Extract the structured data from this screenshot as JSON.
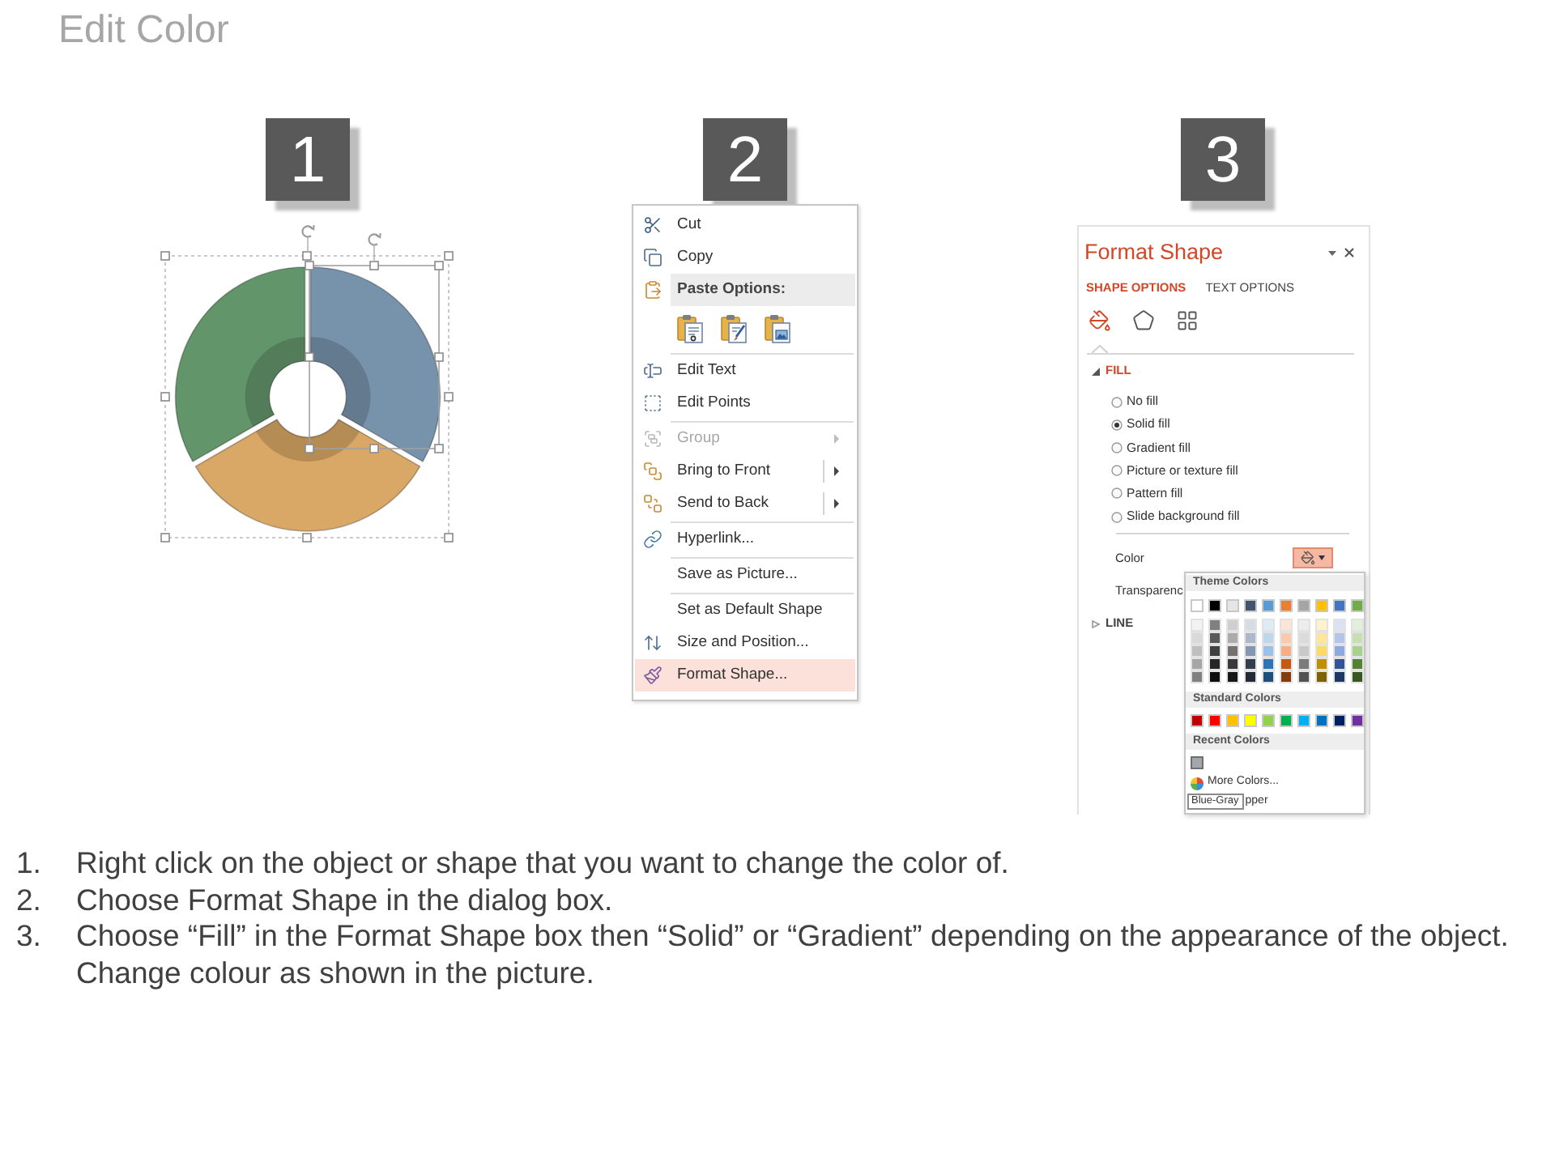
{
  "title": "Edit Color",
  "step_badges": [
    "1",
    "2",
    "3"
  ],
  "illustration": {
    "segments": [
      {
        "color": "#63956b"
      },
      {
        "color": "#7792ab"
      },
      {
        "color": "#d9a766"
      }
    ]
  },
  "context_menu": {
    "entries": [
      {
        "kind": "item",
        "label": "Cut",
        "disabled": false,
        "submenu": false,
        "split_button": false,
        "selected": false
      },
      {
        "kind": "item",
        "label": "Copy",
        "disabled": false,
        "submenu": false,
        "split_button": false,
        "selected": false
      },
      {
        "kind": "header",
        "label": "Paste Options:"
      },
      {
        "kind": "paste_options"
      },
      {
        "kind": "separator"
      },
      {
        "kind": "item",
        "label": "Edit Text",
        "disabled": false,
        "submenu": false,
        "split_button": false,
        "selected": false
      },
      {
        "kind": "item",
        "label": "Edit Points",
        "disabled": false,
        "submenu": false,
        "split_button": false,
        "selected": false
      },
      {
        "kind": "separator"
      },
      {
        "kind": "item",
        "label": "Group",
        "disabled": true,
        "submenu": true,
        "split_button": false,
        "selected": false
      },
      {
        "kind": "item",
        "label": "Bring to Front",
        "disabled": false,
        "submenu": true,
        "split_button": true,
        "selected": false
      },
      {
        "kind": "item",
        "label": "Send to Back",
        "disabled": false,
        "submenu": true,
        "split_button": true,
        "selected": false
      },
      {
        "kind": "separator"
      },
      {
        "kind": "item",
        "label": "Hyperlink...",
        "disabled": false,
        "submenu": false,
        "split_button": false,
        "selected": false
      },
      {
        "kind": "separator"
      },
      {
        "kind": "item",
        "label": "Save as Picture...",
        "disabled": false,
        "submenu": false,
        "split_button": false,
        "selected": false
      },
      {
        "kind": "separator"
      },
      {
        "kind": "item",
        "label": "Set as Default Shape",
        "disabled": false,
        "submenu": false,
        "split_button": false,
        "selected": false
      },
      {
        "kind": "item",
        "label": "Size and Position...",
        "disabled": false,
        "submenu": false,
        "split_button": false,
        "selected": false
      },
      {
        "kind": "item",
        "label": "Format Shape...",
        "disabled": false,
        "submenu": false,
        "split_button": false,
        "selected": true
      }
    ]
  },
  "format_panel": {
    "title": "Format Shape",
    "tabs": [
      {
        "label": "SHAPE OPTIONS",
        "selected": true
      },
      {
        "label": "TEXT OPTIONS",
        "selected": false
      }
    ],
    "icon_tabs": [
      {
        "selected": true
      },
      {
        "selected": false
      },
      {
        "selected": false
      }
    ],
    "fill_section": {
      "label": "FILL",
      "expanded": true
    },
    "fill_options": [
      {
        "label": "No fill",
        "selected": false
      },
      {
        "label": "Solid fill",
        "selected": true
      },
      {
        "label": "Gradient fill",
        "selected": false
      },
      {
        "label": "Picture or texture fill",
        "selected": false
      },
      {
        "label": "Pattern fill",
        "selected": false
      },
      {
        "label": "Slide background fill",
        "selected": false
      }
    ],
    "color_label": "Color",
    "color_button": {
      "open": true
    },
    "transparency_label": "Transparenc",
    "line_section": {
      "label": "LINE",
      "expanded": false
    },
    "palette": {
      "theme_title": "Theme Colors",
      "theme_colors": [
        {
          "color": "#ffffff",
          "shades": [
            {
              "color": "#f2f2f2"
            },
            {
              "color": "#d9d9d9"
            },
            {
              "color": "#bfbfbf"
            },
            {
              "color": "#a6a6a6"
            },
            {
              "color": "#808080"
            }
          ]
        },
        {
          "color": "#000000",
          "shades": [
            {
              "color": "#808080"
            },
            {
              "color": "#595959"
            },
            {
              "color": "#404040"
            },
            {
              "color": "#262626"
            },
            {
              "color": "#0d0d0d"
            }
          ]
        },
        {
          "color": "#e7e6e6",
          "shades": [
            {
              "color": "#d0cece"
            },
            {
              "color": "#aeaaaa"
            },
            {
              "color": "#757171"
            },
            {
              "color": "#3a3838"
            },
            {
              "color": "#171616"
            }
          ]
        },
        {
          "color": "#44546a",
          "shades": [
            {
              "color": "#d6dce4"
            },
            {
              "color": "#adb9ca"
            },
            {
              "color": "#8497b0"
            },
            {
              "color": "#333f4f"
            },
            {
              "color": "#222a35"
            }
          ]
        },
        {
          "color": "#5b9bd5",
          "shades": [
            {
              "color": "#ddebf7"
            },
            {
              "color": "#bdd7ee"
            },
            {
              "color": "#9bc2e6"
            },
            {
              "color": "#2f75b5"
            },
            {
              "color": "#1f4e78"
            }
          ]
        },
        {
          "color": "#ed7d31",
          "shades": [
            {
              "color": "#fce4d6"
            },
            {
              "color": "#f8cbad"
            },
            {
              "color": "#f4b084"
            },
            {
              "color": "#c65911"
            },
            {
              "color": "#833c0c"
            }
          ]
        },
        {
          "color": "#a5a5a5",
          "shades": [
            {
              "color": "#ededed"
            },
            {
              "color": "#dbdbdb"
            },
            {
              "color": "#c9c9c9"
            },
            {
              "color": "#7b7b7b"
            },
            {
              "color": "#525252"
            }
          ]
        },
        {
          "color": "#ffc000",
          "shades": [
            {
              "color": "#fff2cc"
            },
            {
              "color": "#ffe699"
            },
            {
              "color": "#ffd966"
            },
            {
              "color": "#bf8f00"
            },
            {
              "color": "#806000"
            }
          ]
        },
        {
          "color": "#4472c4",
          "shades": [
            {
              "color": "#d9e1f2"
            },
            {
              "color": "#b4c6e7"
            },
            {
              "color": "#8ea9db"
            },
            {
              "color": "#305496"
            },
            {
              "color": "#203764"
            }
          ]
        },
        {
          "color": "#70ad47",
          "shades": [
            {
              "color": "#e2efda"
            },
            {
              "color": "#c6e0b4"
            },
            {
              "color": "#a9d08e"
            },
            {
              "color": "#548235"
            },
            {
              "color": "#375623"
            }
          ]
        }
      ],
      "standard_title": "Standard Colors",
      "standard_colors": [
        {
          "color": "#c00000"
        },
        {
          "color": "#ff0000"
        },
        {
          "color": "#ffc000"
        },
        {
          "color": "#ffff00"
        },
        {
          "color": "#92d050"
        },
        {
          "color": "#00b050"
        },
        {
          "color": "#00b0f0"
        },
        {
          "color": "#0070c0"
        },
        {
          "color": "#002060"
        },
        {
          "color": "#7030a0"
        }
      ],
      "recent_title": "Recent Colors",
      "recent_colors": [
        {
          "color": "#a3a6aa"
        }
      ],
      "more_colors_label": "More Colors...",
      "tooltip": "Blue-Gray",
      "eyedropper_label": "pper"
    }
  },
  "instructions": [
    {
      "number": "1.",
      "text": "Right click on the object or shape that you want to change the color of."
    },
    {
      "number": "2.",
      "text": "Choose Format Shape in the dialog box."
    },
    {
      "number": "3.",
      "text": "Choose “Fill” in the Format Shape box then “Solid” or “Gradient” depending on the appearance of the object. Change colour as shown in the picture."
    }
  ]
}
